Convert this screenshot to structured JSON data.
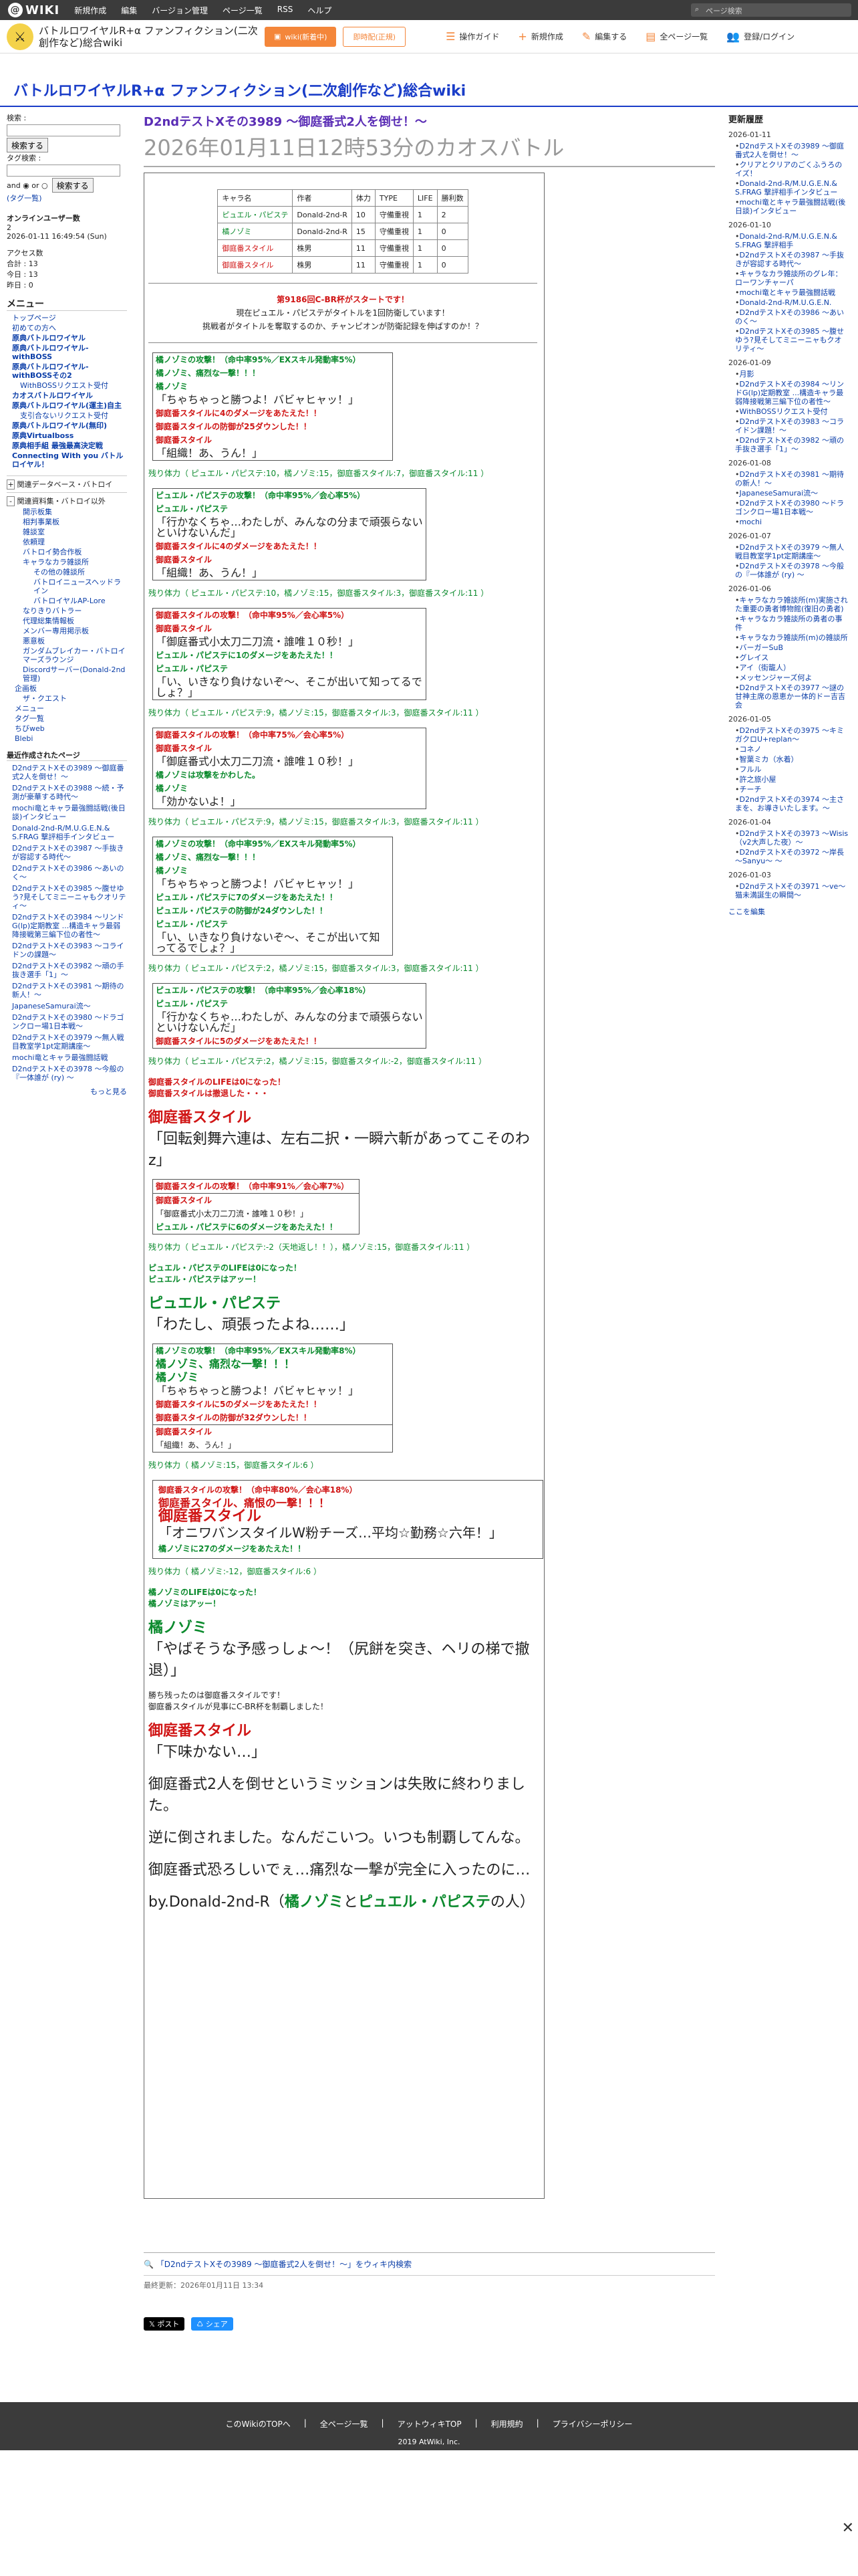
{
  "topbar": {
    "logo": "WIKI",
    "menu": [
      "新規作成",
      "編集",
      "バージョン管理",
      "ページ一覧",
      "RSS",
      "ヘルプ"
    ],
    "search_placeholder": "ページ検索"
  },
  "header": {
    "wiki_name": "バトルロワイヤルR+α ファンフィクション(二次創作など)総合wiki",
    "btn_wiki": "wiki(新着中)",
    "btn_event": "即時配(正規)",
    "links": [
      "操作ガイド",
      "新規作成",
      "編集する",
      "全ページ一覧",
      "登録/ログイン"
    ]
  },
  "page_title": "バトルロワイヤルR+α ファンフィクション(二次創作など)総合wiki",
  "left": {
    "search_label": "検索 :",
    "search_btn": "検索する",
    "tag_label": "タグ検索 :",
    "tag_btn": "検索する",
    "tag_mode": "and ◉ or ○",
    "tag_note": "(タグ一覧)",
    "online": "オンラインユーザー数",
    "online_count": "2",
    "date": "2026-01-11 16:49:54 (Sun)",
    "access_title": "アクセス数",
    "access_total": "合計 : 13",
    "access_today": "今日 : 13",
    "access_yesterday": "昨日 : 0",
    "menu_title": "メニュー",
    "menu_items": [
      "トップページ",
      "初めての方へ",
      "原典バトルロワイヤル",
      "原典バトルロワイヤル-withBOSS",
      "原典バトルロワイヤル-withBOSSその2",
      "WithBOSSリクエスト受付",
      "カオスバトルロワイヤル",
      "原典バトルロワイヤル(運主)自主",
      "支引合ないリクエスト受付",
      "原典バトルロワイヤル(無印)",
      "原典Virtualboss",
      "原典相手組 最強最高決定戦",
      "Connecting With you バトルロイヤル！"
    ],
    "sub_title": "関連データベース・バトロイ",
    "sub_title2": "関連資料集・バトロイ以外",
    "sub_items": [
      "開示板集",
      "相判事業板",
      "雑談室",
      "依頼理",
      "バトロイ勢合作板",
      "キャラなカラ雑談所",
      "その他の雑談所",
      "バトロイニュースヘッドライン",
      "バトロイヤルAP-Lore",
      "なりきりバトラー",
      "代理総集情報板",
      "メンバー専用掲示板",
      "悪意板",
      "ガンダムブレイカー・バトロイマーズラウンジ",
      "Discordサーバー(Donald-2nd管理)",
      "企画板",
      "ザ・クエスト",
      "メニュー",
      "タグ一覧",
      "ちびweb",
      "Blebi"
    ],
    "recent_title": "最近作成されたページ",
    "recent": [
      "D2ndテストXその3989 〜御庭番式2人を倒せ！〜",
      "D2ndテストXその3988 〜続・予測が豪華する時代〜",
      "mochi竜とキャラ最強闘話戦(後日談)インタビュー",
      "Donald-2nd-R/M.U.G.E.N.& S.FRAG 撃評相手インタビュー",
      "D2ndテストXその3987 〜手抜きが容認する時代〜",
      "D2ndテストXその3986 〜あいのく〜",
      "D2ndテストXその3985 〜腹せゆう?見そしてミニーニャもクオリティ〜",
      "D2ndテストXその3984 〜リンドG(lp)定期教室 ...構造キャラ最弱降接戦第三編下位の者性〜",
      "D2ndテストXその3983 〜コライドンの課題〜",
      "D2ndテストXその3982 〜頑の手抜き選手「1」〜",
      "D2ndテストXその3981 〜期待の新人！〜",
      "JapaneseSamurai流〜",
      "D2ndテストXその3980 〜ドラゴンクロー場1日本戦〜",
      "D2ndテストXその3979 〜無人戦目教室学1pt定期講座〜",
      "mochi竜とキャラ最強闘話戦",
      "D2ndテストXその3978 〜今般の『一体誰が (ry) 〜"
    ],
    "more": "もっと見る"
  },
  "main": {
    "title": "D2ndテストXその3989 〜御庭番式2人を倒せ！〜",
    "subtitle": "2026年01月11日12時53分のカオスバトル",
    "table_headers": [
      "キャラ名",
      "作者",
      "体力",
      "TYPE",
      "LIFE",
      "勝利数"
    ],
    "table_rows": [
      [
        "ピュエル・パピステ",
        "Donald-2nd-R",
        "10",
        "守備重視",
        "1",
        "2"
      ],
      [
        "橘ノゾミ",
        "Donald-2nd-R",
        "15",
        "守備重視",
        "1",
        "0"
      ],
      [
        "御庭番スタイル",
        "株男",
        "11",
        "守備重視",
        "1",
        "0"
      ],
      [
        "御庭番スタイル",
        "株男",
        "11",
        "守備重視",
        "1",
        "0"
      ]
    ],
    "intro1": "第9186回C-BR杯がスタートです！",
    "intro2": "現在ピュエル・パピステがタイトルを1回防衛しています！",
    "intro3": "挑戦者がタイトルを奪取するのか、チャンピオンが防衛記録を伸ばすのか！？",
    "blocks": [
      {
        "lines": [
          "橘ノゾミの攻撃！（命中率95%／EXスキル発動率5%）",
          "橘ノゾミ、痛烈な一撃！！！",
          "橘ノゾミ",
          "「ちゃちゃっと勝つよ！バビャヒャッ！」",
          "御庭番スタイルに4のダメージをあたえた！！",
          "御庭番スタイルの防御が25ダウンした！！",
          "御庭番スタイル",
          "「組織！あ、うん！」"
        ],
        "remain": "残り体力（ ピュエル・パピステ:10，橘ノゾミ:15，御庭番スタイル:7，御庭番スタイル:11 ）"
      },
      {
        "lines": [
          "ピュエル・パピステの攻撃！（命中率95%／会心率5%）",
          "ピュエル・パピステ",
          "「行かなくちゃ…わたしが、みんなの分まで頑張らないといけないんだ」",
          "御庭番スタイルに4のダメージをあたえた！！",
          "御庭番スタイル",
          "「組織！あ、うん！」"
        ],
        "remain": "残り体力（ ピュエル・パピステ:10，橘ノゾミ:15，御庭番スタイル:3，御庭番スタイル:11 ）"
      },
      {
        "lines": [
          "御庭番スタイルの攻撃！（命中率95%／会心率5%）",
          "御庭番スタイル",
          "「御庭番式小太刀二刀流・誰唯１０秒！」",
          "ピュエル・パピステに1のダメージをあたえた！！",
          "ピュエル・パピステ",
          "「い、いきなり負けないぞ～、そこが出いて知ってるでしょ？」"
        ],
        "remain": "残り体力（ ピュエル・パピステ:9，橘ノゾミ:15，御庭番スタイル:3，御庭番スタイル:11 ）"
      },
      {
        "lines": [
          "御庭番スタイルの攻撃！（命中率75%／会心率5%）",
          "御庭番スタイル",
          "「御庭番式小太刀二刀流・誰唯１０秒！」",
          "橘ノゾミは攻撃をかわした。",
          "橘ノゾミ",
          "「効かないよ！」"
        ],
        "remain": "残り体力（ ピュエル・パピステ:9，橘ノゾミ:15，御庭番スタイル:3，御庭番スタイル:11 ）"
      },
      {
        "lines": [
          "橘ノゾミの攻撃！（命中率95%／EXスキル発動率5%）",
          "橘ノゾミ、痛烈な一撃！！！",
          "橘ノゾミ",
          "「ちゃちゃっと勝つよ！バビャヒャッ！」",
          "ピュエル・パピステに7のダメージをあたえた！！",
          "ピュエル・パピステの防御が24ダウンした！！",
          "ピュエル・パピステ",
          "「い、いきなり負けないぞ～、そこが出いて知ってるでしょ？」"
        ],
        "remain": "残り体力（ ピュエル・パピステ:2，橘ノゾミ:15，御庭番スタイル:3，御庭番スタイル:11 ）"
      },
      {
        "lines": [
          "ピュエル・パピステの攻撃！（命中率95%／会心率18%）",
          "ピュエル・パピステ",
          "「行かなくちゃ…わたしが、みんなの分まで頑張らないといけないんだ」",
          "御庭番スタイルに5のダメージをあたえた！！"
        ],
        "remain": "残り体力（ ピュエル・パピステ:2，橘ノゾミ:15，御庭番スタイル:-2，御庭番スタイル:11 ）"
      }
    ],
    "ko1a": "御庭番スタイルのLIFEは0になった！",
    "ko1b": "御庭番スタイルは撤退した・・・",
    "ko1name": "御庭番スタイル",
    "ko1quote": "「回転剣舞六連は、左右二択・一瞬六斬があってこそのわz」",
    "block7": [
      "御庭番スタイルの攻撃！（命中率91%／会心率7%）",
      "御庭番スタイル",
      "「御庭番式小太刀二刀流・誰唯１０秒！」",
      "ピュエル・パピステに6のダメージをあたえた！！"
    ],
    "remain7": "残り体力（ ピュエル・パピステ:-2（天地返し！！），橘ノゾミ:15，御庭番スタイル:11 ）",
    "ko2a": "ピュエル・パピステのLIFEは0になった！",
    "ko2b": "ピュエル・パピステはアッー！",
    "ko2name": "ピュエル・パピステ",
    "ko2quote": "「わたし、頑張ったよね……」",
    "block8": [
      "橘ノゾミの攻撃！（命中率95%／EXスキル発動率8%）",
      "橘ノゾミ、痛烈な一撃！！！",
      "橘ノゾミ",
      "「ちゃちゃっと勝つよ！バビャヒャッ！」",
      "御庭番スタイルに5のダメージをあたえた！！",
      "御庭番スタイルの防御が32ダウンした！！",
      "御庭番スタイル",
      "「組織！あ、うん！」"
    ],
    "remain8": "残り体力（ 橘ノゾミ:15，御庭番スタイル:6 ）",
    "block9a": "御庭番スタイルの攻撃！（命中率80%／会心率18%）",
    "block9b": "御庭番スタイル、痛恨の一撃！！！",
    "block9name": "御庭番スタイル",
    "block9quote": "「オニワバンスタイルW粉チーズ…平均☆勤務☆六年！」",
    "block9dmg": "橘ノゾミに27のダメージをあたえた！！",
    "remain9": "残り体力（ 橘ノゾミ:-12，御庭番スタイル:6 ）",
    "ko3a": "橘ノゾミのLIFEは0になった！",
    "ko3b": "橘ノゾミはアッー！",
    "ko3name": "橘ノゾミ",
    "ko3quote": "「やばそうな予感っしょ～！（尻餅を突き、ヘリの梯で撤退）」",
    "win1": "勝ち残ったのは御庭番スタイルです！",
    "win2": "御庭番スタイルが見事にC-BR杯を制覇しました！",
    "winname": "御庭番スタイル",
    "winquote": "「下味かない…」",
    "end1": "御庭番式2人を倒せというミッションは失敗に終わりました。",
    "end2": "逆に倒されました。なんだこいつ。いつも制覇してんな。",
    "end3": "御庭番式恐ろしいでぇ…痛烈な一撃が完全に入ったのに…",
    "end4a": "by.Donald-2nd-R（",
    "end4b": "橘ノゾミ",
    "end4c": "と",
    "end4d": "ピュエル・パピステ",
    "end4e": "の人）"
  },
  "below": {
    "search_link": "「D2ndテストXその3989 〜御庭番式2人を倒せ！〜」をウィキ内検索",
    "updated": "最終更新：2026年01月11日 13:34",
    "post": "ポスト",
    "share": "シェア"
  },
  "right": {
    "title": "更新履歴",
    "groups": [
      {
        "date": "2026-01-11",
        "items": [
          "D2ndテストXその3989 〜御庭番式2人を倒せ！〜",
          "クリアとクリアのごくふうろのイズ！",
          "Donald-2nd-R/M.U.G.E.N.& S.FRAG 撃評相手インタビュー",
          "mochi竜とキャラ最強闘話戦(後日談)インタビュー"
        ]
      },
      {
        "date": "2026-01-10",
        "items": [
          "Donald-2nd-R/M.U.G.E.N.& S.FRAG 撃評相手",
          "D2ndテストXその3987 〜手抜きが容認する時代〜",
          "キャラなカラ雑談所のグレ年：ローワンチャーパ",
          "mochi竜とキャラ最強闘話戦",
          "Donald-2nd-R/M.U.G.E.N.",
          "D2ndテストXその3986 〜あいのく〜",
          "D2ndテストXその3985 〜腹せゆう?見そしてミニーニャもクオリティ〜"
        ]
      },
      {
        "date": "2026-01-09",
        "items": [
          "月影",
          "D2ndテストXその3984 〜リンドG(lp)定期教室 ...構造キャラ最弱降接戦第三編下位の者性〜",
          "WithBOSSリクエスト受付",
          "D2ndテストXその3983 〜コラ イドン課題！〜",
          "D2ndテストXその3982 〜頑の手抜き選手「1」〜"
        ]
      },
      {
        "date": "2026-01-08",
        "items": [
          "D2ndテストXその3981 〜期待の新人！〜",
          "JapaneseSamurai流〜",
          "D2ndテストXその3980 〜ドラゴンクロー場1日本戦〜",
          "mochi"
        ]
      },
      {
        "date": "2026-01-07",
        "items": [
          "D2ndテストXその3979 〜無人戦目教室学1pt定期講座〜",
          "D2ndテストXその3978 〜今般の『一体誰が (ry) 〜"
        ]
      },
      {
        "date": "2026-01-06",
        "items": [
          "キャラなカラ雑談所(m)実施された重要の勇者博物館(復旧の勇者)",
          "キャラなカラ雑談所の勇者の事件",
          "キャラなカラ雑談所(m)の雑談所",
          "バーガーSuB",
          "グレイス",
          "アイ（街籠人）",
          "メッセンジャーズ何よ",
          "D2ndテストXその3977 〜謎の甘神主席の恩恵かー体的ドー吉吉会"
        ]
      },
      {
        "date": "2026-01-05",
        "items": [
          "D2ndテストXその3975 〜キミガクロU+replan〜",
          "コネノ",
          "智葉ミカ（水着）",
          "フルル",
          "許之旅小屋",
          "チーチ",
          "D2ndテストXその3974 〜主さまを、お導きいたします。〜"
        ]
      },
      {
        "date": "2026-01-04",
        "items": [
          "D2ndテストXその3973 〜Wisis（v2大声した夜）〜",
          "D2ndテストXその3972 〜岸長 〜Sanyu〜 〜"
        ]
      },
      {
        "date": "2026-01-03",
        "items": [
          "D2ndテストXその3971 〜ve〜猫未満誕生の瞬間〜"
        ]
      }
    ],
    "edit_link": "ここを編集"
  },
  "footer": {
    "links": [
      "このWikiのTOPへ",
      "全ページ一覧",
      "アットウィキTOP",
      "利用規約",
      "プライバシーポリシー"
    ],
    "copy": "2019 AtWiki, Inc."
  },
  "colors": {
    "accent": "#f4863a",
    "link": "#0b3ea8",
    "title": "#1a3dc8",
    "red": "#d01515",
    "green": "#0b8a2d",
    "purple": "#5a2db5"
  }
}
